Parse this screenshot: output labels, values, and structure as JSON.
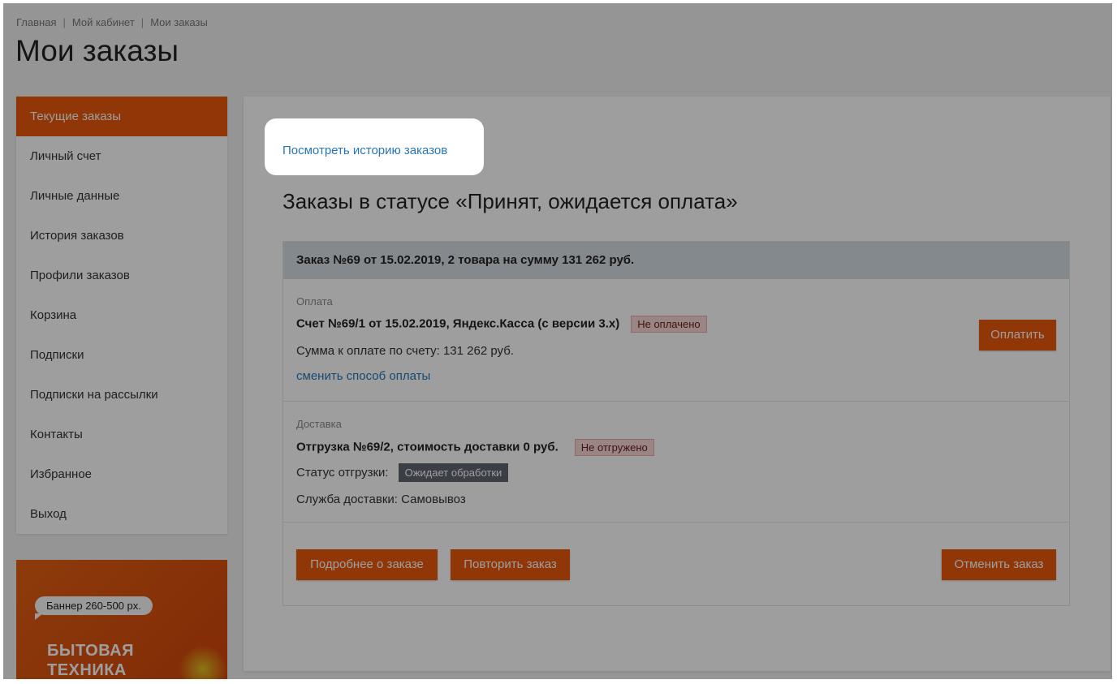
{
  "breadcrumb": [
    "Главная",
    "Мой кабинет",
    "Мои заказы"
  ],
  "page_title": "Мои заказы",
  "sidebar": {
    "items": [
      {
        "label": "Текущие заказы",
        "active": true
      },
      {
        "label": "Личный счет"
      },
      {
        "label": "Личные данные"
      },
      {
        "label": "История заказов"
      },
      {
        "label": "Профили заказов"
      },
      {
        "label": "Корзина"
      },
      {
        "label": "Подписки"
      },
      {
        "label": "Подписки на рассылки"
      },
      {
        "label": "Контакты"
      },
      {
        "label": "Избранное"
      },
      {
        "label": "Выход"
      }
    ]
  },
  "banner": {
    "bubble": "Баннер 260-500 px.",
    "line1": "БЫТОВАЯ",
    "line2": "ТЕХНИКА"
  },
  "main": {
    "history_link": "Посмотреть историю заказов",
    "status_title": "Заказы в статусе «Принят, ожидается оплата»"
  },
  "order": {
    "header": "Заказ №69 от 15.02.2019, 2 товара на сумму 131 262 руб.",
    "payment": {
      "label": "Оплата",
      "title": "Счет №69/1 от 15.02.2019,  Яндекс.Касса (с версии 3.х)",
      "badge": "Не оплачено",
      "amount": "Сумма к оплате по счету: 131 262 руб.",
      "change_link": "сменить способ оплаты",
      "pay_button": "Оплатить"
    },
    "delivery": {
      "label": "Доставка",
      "title": "Отгрузка №69/2, стоимость доставки 0 руб.",
      "badge": "Не отгружено",
      "status_label": "Статус отгрузки:",
      "status_badge": "Ожидает обработки",
      "service": "Служба доставки: Самовывоз"
    },
    "buttons": {
      "details": "Подробнее о заказе",
      "repeat": "Повторить заказ",
      "cancel": "Отменить заказ"
    }
  },
  "colors": {
    "accent": "#e8570c",
    "link": "#2775b6",
    "order_header": "#d6dde4"
  }
}
